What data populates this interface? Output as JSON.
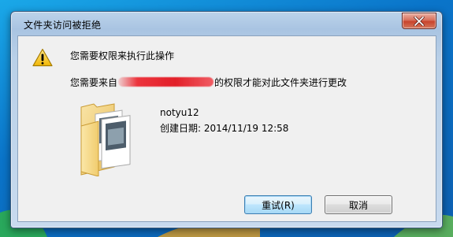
{
  "dialog": {
    "title": "文件夹访问被拒绝",
    "close_icon": "close-icon",
    "message_title": "您需要权限来执行此操作",
    "message_prefix": "您需要来自",
    "message_suffix": "的权限才能对此文件夹进行更改",
    "warning_icon": "warning-icon",
    "folder_icon": "folder-icon"
  },
  "file": {
    "name": "notyu12",
    "created": "创建日期: 2014/11/19 12:58"
  },
  "buttons": {
    "retry_label": "重试(R)",
    "cancel_label": "取消"
  },
  "colors": {
    "title_bar": "#a9c4e2",
    "close_button": "#c8432c",
    "client_bg": "#f0f0f0",
    "redaction": "#e6141e"
  }
}
